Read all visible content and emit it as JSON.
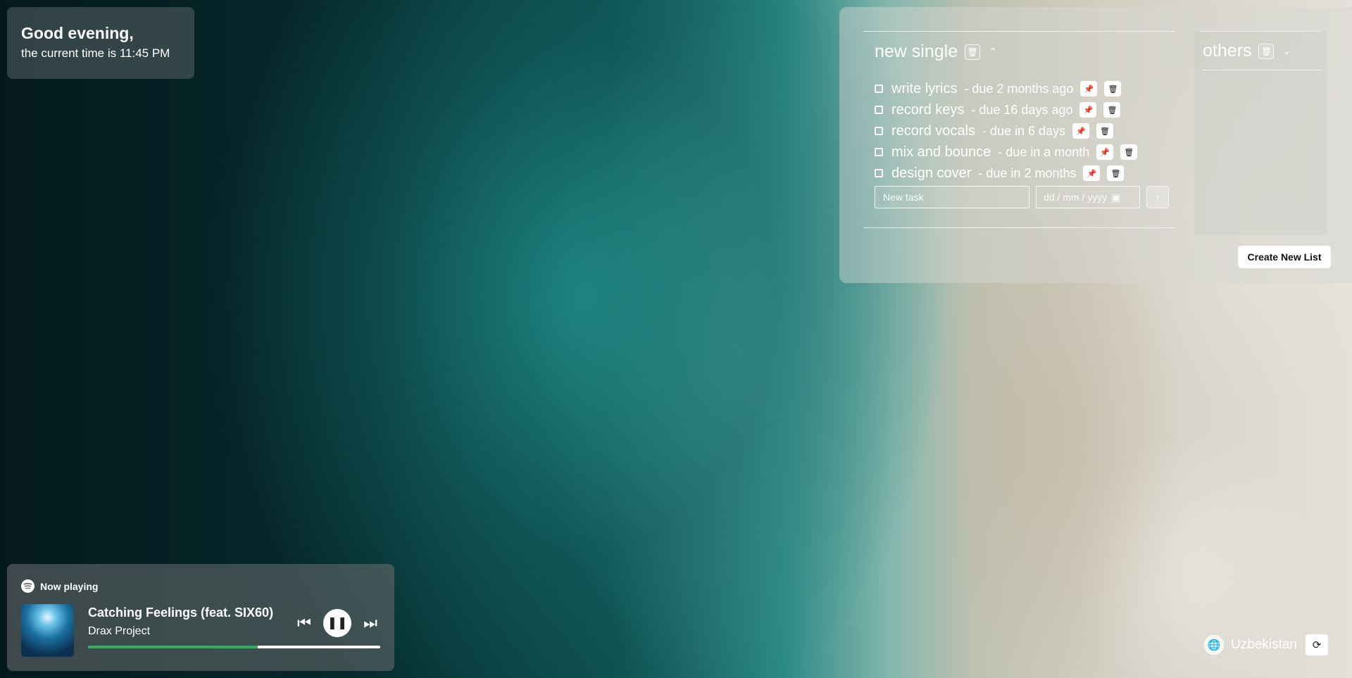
{
  "greeting": {
    "title": "Good evening,",
    "subtitle": "the current time is 11:45 PM"
  },
  "todo": {
    "active_list": {
      "title": "new single",
      "delete_icon": "trash-icon",
      "collapse_icon": "chevron-up-icon",
      "tasks": [
        {
          "name": "write lyrics",
          "due": "- due 2 months ago"
        },
        {
          "name": "record keys",
          "due": "- due 16 days ago"
        },
        {
          "name": "record vocals",
          "due": "- due in 6 days"
        },
        {
          "name": "mix and bounce",
          "due": "- due in a month"
        },
        {
          "name": "design cover",
          "due": "- due in 2 months"
        }
      ],
      "new_task_placeholder": "New task",
      "date_placeholder": "dd / mm / yyyy"
    },
    "other_list": {
      "title": "others",
      "expand_icon": "chevron-down-icon"
    },
    "create_button": "Create New List"
  },
  "player": {
    "label": "Now playing",
    "track": "Catching Feelings (feat. SIX60)",
    "artist": "Drax Project",
    "progress": 0.58,
    "progress_color": "#2bb35a"
  },
  "location": {
    "name": "Uzbekistan",
    "icon": "globe-icon",
    "refresh_icon": "refresh-icon"
  }
}
